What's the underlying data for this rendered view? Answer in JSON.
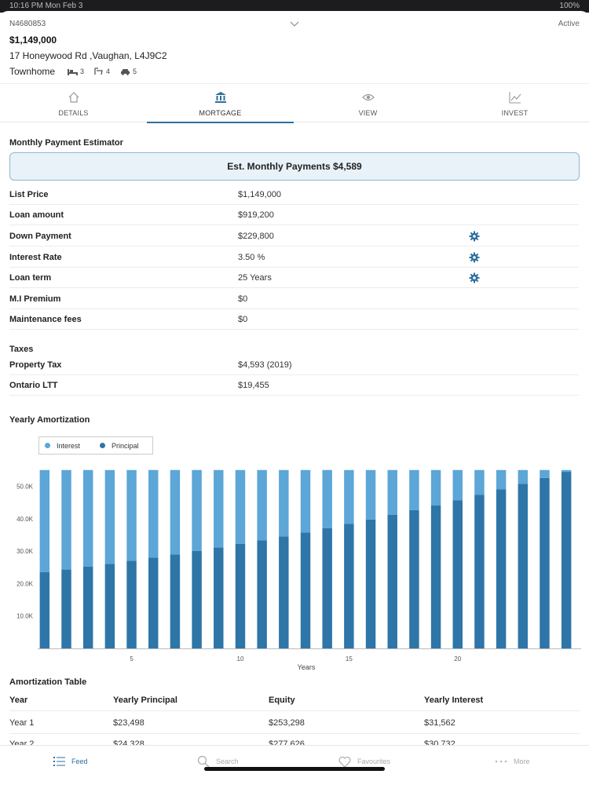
{
  "status_bar": {
    "time": "10:16 PM  Mon Feb 3",
    "battery": "100%"
  },
  "listing": {
    "mls": "N4680853",
    "status": "Active",
    "price": "$1,149,000",
    "address": "17 Honeywood Rd ,Vaughan, L4J9C2",
    "type": "Townhome",
    "beds": "3",
    "baths": "4",
    "parking": "5"
  },
  "tabs": [
    {
      "label": "DETAILS",
      "icon": "home-icon"
    },
    {
      "label": "MORTGAGE",
      "icon": "bank-icon",
      "active": true
    },
    {
      "label": "VIEW",
      "icon": "eye-icon"
    },
    {
      "label": "INVEST",
      "icon": "chart-line-icon"
    }
  ],
  "estimator": {
    "title": "Monthly Payment Estimator",
    "summary": "Est. Monthly Payments $4,589",
    "rows": [
      {
        "label": "List Price",
        "value": "$1,149,000"
      },
      {
        "label": "Loan amount",
        "value": "$919,200"
      },
      {
        "label": "Down Payment",
        "value": "$229,800",
        "settings": true
      },
      {
        "label": "Interest Rate",
        "value": "3.50 %",
        "settings": true
      },
      {
        "label": "Loan term",
        "value": "25 Years",
        "settings": true
      },
      {
        "label": "M.I Premium",
        "value": "$0"
      },
      {
        "label": "Maintenance fees",
        "value": "$0"
      }
    ]
  },
  "taxes": {
    "title": "Taxes",
    "rows": [
      {
        "label": "Property Tax",
        "value": "$4,593 (2019)"
      },
      {
        "label": "Ontario LTT",
        "value": "$19,455"
      }
    ]
  },
  "amortization_chart_title": "Yearly Amortization",
  "chart_data": {
    "type": "bar",
    "stacked": true,
    "x": [
      1,
      2,
      3,
      4,
      5,
      6,
      7,
      8,
      9,
      10,
      11,
      12,
      13,
      14,
      15,
      16,
      17,
      18,
      19,
      20,
      21,
      22,
      23,
      24,
      25
    ],
    "xlabel": "Years",
    "ylabel": "",
    "xticks": [
      "5",
      "10",
      "15",
      "20"
    ],
    "yticks": [
      "10.0K",
      "20.0K",
      "30.0K",
      "40.0K",
      "50.0K"
    ],
    "ylim": [
      0,
      55000
    ],
    "legend_position": "top-left",
    "series": [
      {
        "name": "Principal",
        "color": "#2e75a8",
        "values": [
          23498,
          24330,
          25200,
          26110,
          27040,
          28000,
          29000,
          30050,
          31120,
          32230,
          33380,
          34570,
          35800,
          37080,
          38400,
          39770,
          41190,
          42660,
          44180,
          45750,
          47380,
          49070,
          50820,
          52630,
          54500
        ]
      },
      {
        "name": "Interest",
        "color": "#5ca6d8",
        "values": [
          31562,
          30730,
          29860,
          28950,
          28020,
          27060,
          26060,
          25010,
          23940,
          22830,
          21680,
          20490,
          19260,
          17980,
          16660,
          15290,
          13870,
          12400,
          10880,
          9310,
          7680,
          5990,
          4240,
          2430,
          560
        ]
      }
    ]
  },
  "amortization_table": {
    "title": "Amortization Table",
    "headers": [
      "Year",
      "Yearly Principal",
      "Equity",
      "Yearly Interest"
    ],
    "rows": [
      [
        "Year 1",
        "$23,498",
        "$253,298",
        "$31,562"
      ],
      [
        "Year 2",
        "$24,328",
        "$277,626",
        "$30,732"
      ]
    ]
  },
  "bottom_nav": [
    {
      "label": "Feed",
      "icon": "list-icon",
      "active": true
    },
    {
      "label": "Search",
      "icon": "search-icon"
    },
    {
      "label": "Favourites",
      "icon": "heart-icon"
    },
    {
      "label": "More",
      "icon": "more-dots-icon"
    }
  ],
  "colors": {
    "accent": "#2e6f9e",
    "principal": "#2e75a8",
    "interest": "#5ca6d8",
    "estimate_bg": "#e9f2f8"
  }
}
